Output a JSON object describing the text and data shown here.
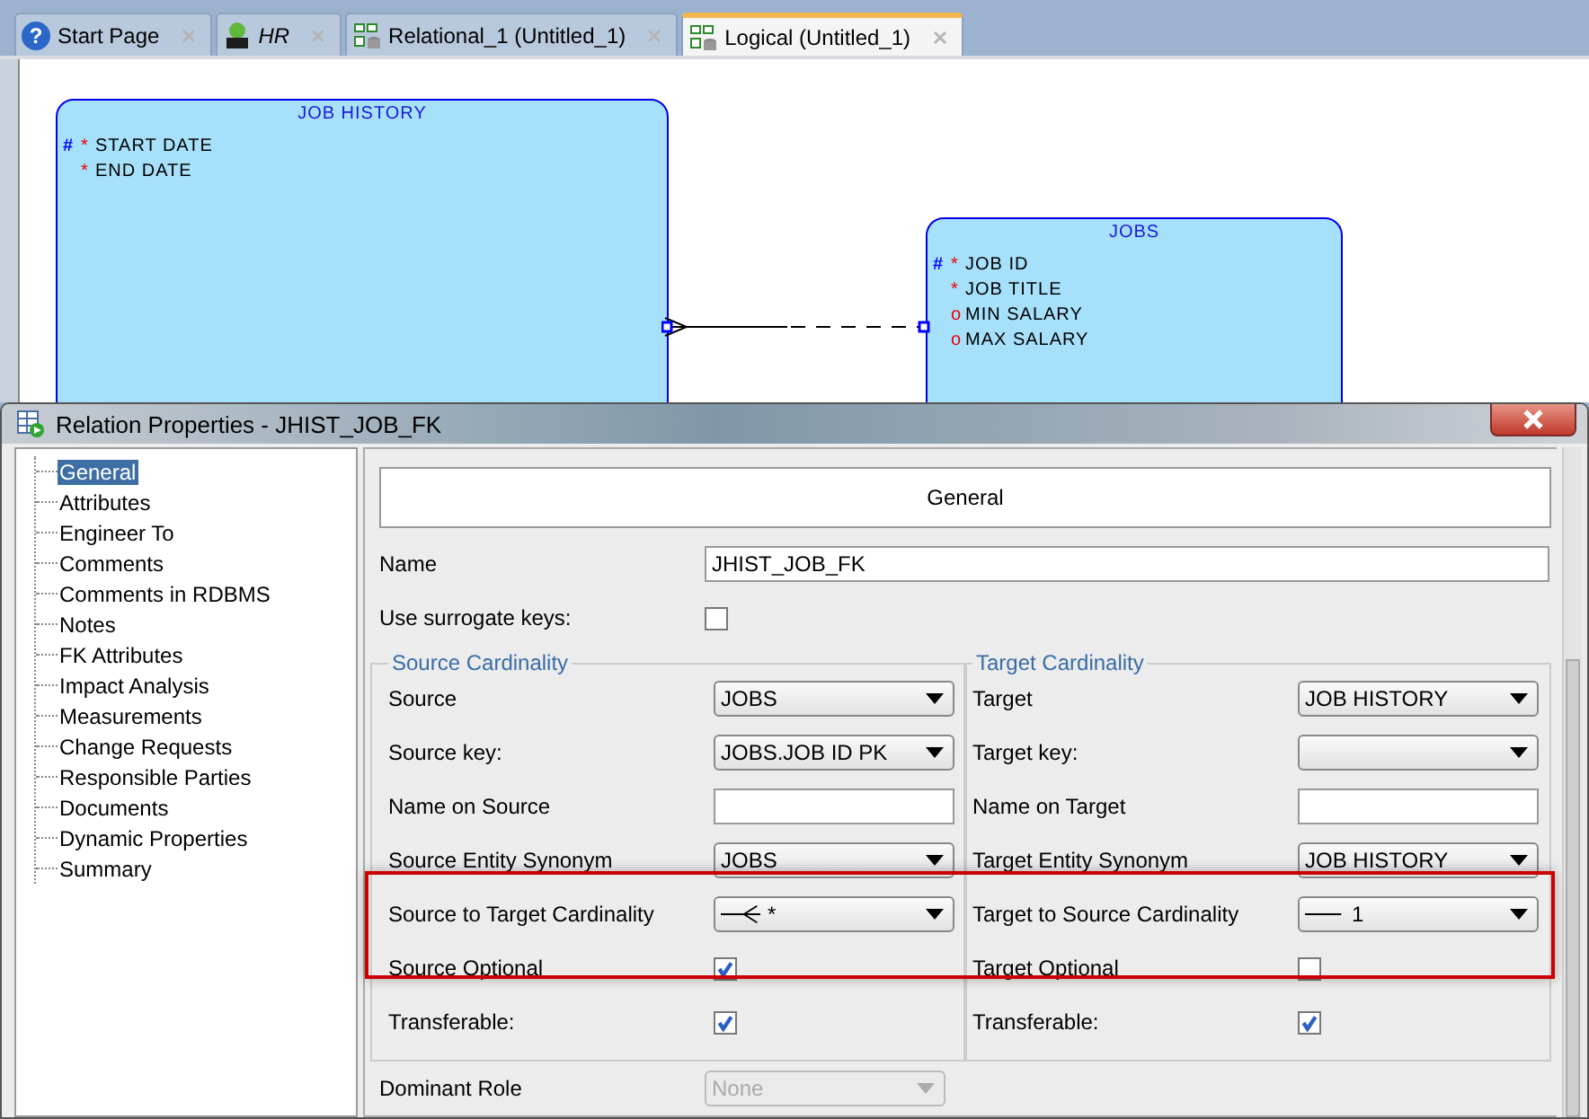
{
  "tabs": [
    {
      "label": "Start Page",
      "kind": "help",
      "icon_text": "?",
      "selected": false
    },
    {
      "label": "HR",
      "kind": "connection",
      "selected": false
    },
    {
      "label": "Relational_1 (Untitled_1)",
      "kind": "model",
      "selected": false
    },
    {
      "label": "Logical (Untitled_1)",
      "kind": "model",
      "selected": true
    }
  ],
  "diagram": {
    "entities": [
      {
        "title": "JOB HISTORY",
        "attributes": [
          {
            "pk": "#",
            "mark": "*",
            "name": "START DATE"
          },
          {
            "mark": "*",
            "name": "END DATE"
          }
        ]
      },
      {
        "title": "JOBS",
        "attributes": [
          {
            "pk": "#",
            "mark": "*",
            "name": "JOB ID"
          },
          {
            "mark": "*",
            "name": "JOB TITLE"
          },
          {
            "mark": "o",
            "name": "MIN SALARY"
          },
          {
            "mark": "o",
            "name": "MAX SALARY"
          }
        ]
      }
    ]
  },
  "dialog": {
    "title": "Relation Properties - JHIST_JOB_FK",
    "tree": [
      {
        "label": "General",
        "selected": true
      },
      {
        "label": "Attributes",
        "selected": false
      },
      {
        "label": "Engineer To",
        "selected": false
      },
      {
        "label": "Comments",
        "selected": false
      },
      {
        "label": "Comments in RDBMS",
        "selected": false
      },
      {
        "label": "Notes",
        "selected": false
      },
      {
        "label": "FK Attributes",
        "selected": false
      },
      {
        "label": "Impact Analysis",
        "selected": false
      },
      {
        "label": "Measurements",
        "selected": false
      },
      {
        "label": "Change Requests",
        "selected": false
      },
      {
        "label": "Responsible Parties",
        "selected": false
      },
      {
        "label": "Documents",
        "selected": false
      },
      {
        "label": "Dynamic Properties",
        "selected": false
      },
      {
        "label": "Summary",
        "selected": false
      }
    ],
    "header": "General",
    "name": {
      "label": "Name",
      "value": "JHIST_JOB_FK"
    },
    "surrogate": {
      "label": "Use surrogate keys:",
      "checked": false
    },
    "groups": [
      {
        "title": "Source Cardinality",
        "rows": [
          {
            "kind": "select",
            "label": "Source",
            "value": "JOBS"
          },
          {
            "kind": "select",
            "label": "Source key:",
            "value": "JOBS.JOB ID PK"
          },
          {
            "kind": "input",
            "label": "Name on Source"
          },
          {
            "kind": "select",
            "label": "Source Entity Synonym",
            "value": "JOBS"
          },
          {
            "kind": "cardinality",
            "label": "Source to Target Cardinality",
            "many": true,
            "value": "*"
          },
          {
            "kind": "check",
            "label": "Source Optional",
            "checked": true
          },
          {
            "kind": "check",
            "label": "Transferable:",
            "checked": true
          }
        ]
      },
      {
        "title": "Target Cardinality",
        "rows": [
          {
            "kind": "select",
            "label": "Target",
            "value": "JOB HISTORY"
          },
          {
            "kind": "select",
            "label": "Target key:"
          },
          {
            "kind": "input",
            "label": "Name on Target"
          },
          {
            "kind": "select",
            "label": "Target Entity Synonym",
            "value": "JOB HISTORY"
          },
          {
            "kind": "cardinality",
            "label": "Target to Source Cardinality",
            "many": false,
            "value": "1"
          },
          {
            "kind": "check",
            "label": "Target Optional",
            "checked": false
          },
          {
            "kind": "check",
            "label": "Transferable:",
            "checked": true
          }
        ]
      }
    ],
    "dominant": {
      "label": "Dominant Role",
      "value": "None",
      "disabled": true
    }
  }
}
